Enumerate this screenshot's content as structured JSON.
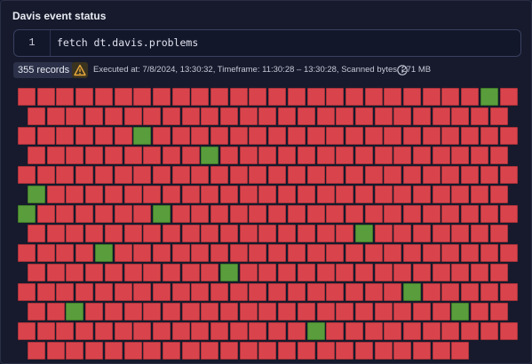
{
  "panel": {
    "title": "Davis event status"
  },
  "query": {
    "line_number": "1",
    "text": "fetch dt.davis.problems"
  },
  "status": {
    "records": "355 records",
    "executed": "Executed at: 7/8/2024, 13:30:32, Timeframe: 11:30:28 – 13:30:28, Scanned bytes: 271 MB"
  },
  "honeycomb": {
    "total_tiles": 355,
    "rows": [
      {
        "count": 26,
        "offset": "even"
      },
      {
        "count": 25,
        "offset": "odd"
      },
      {
        "count": 26,
        "offset": "even"
      },
      {
        "count": 25,
        "offset": "odd"
      },
      {
        "count": 26,
        "offset": "even"
      },
      {
        "count": 25,
        "offset": "odd"
      },
      {
        "count": 26,
        "offset": "even"
      },
      {
        "count": 25,
        "offset": "odd"
      },
      {
        "count": 26,
        "offset": "even"
      },
      {
        "count": 25,
        "offset": "odd"
      },
      {
        "count": 26,
        "offset": "even"
      },
      {
        "count": 25,
        "offset": "odd"
      },
      {
        "count": 26,
        "offset": "even"
      },
      {
        "count": 23,
        "offset": "odd"
      }
    ],
    "green_tiles": [
      {
        "row": 0,
        "col": 24
      },
      {
        "row": 2,
        "col": 6
      },
      {
        "row": 3,
        "col": 9
      },
      {
        "row": 5,
        "col": 0
      },
      {
        "row": 6,
        "col": 0
      },
      {
        "row": 6,
        "col": 7
      },
      {
        "row": 7,
        "col": 17
      },
      {
        "row": 8,
        "col": 4
      },
      {
        "row": 9,
        "col": 10
      },
      {
        "row": 10,
        "col": 20
      },
      {
        "row": 11,
        "col": 2
      },
      {
        "row": 11,
        "col": 22
      },
      {
        "row": 12,
        "col": 15
      }
    ],
    "colors": {
      "problem": "#d9444c",
      "problem_border": "#a8323a",
      "ok": "#5a9d3c",
      "ok_border": "#3f7a28",
      "background": "#161a2c"
    }
  }
}
